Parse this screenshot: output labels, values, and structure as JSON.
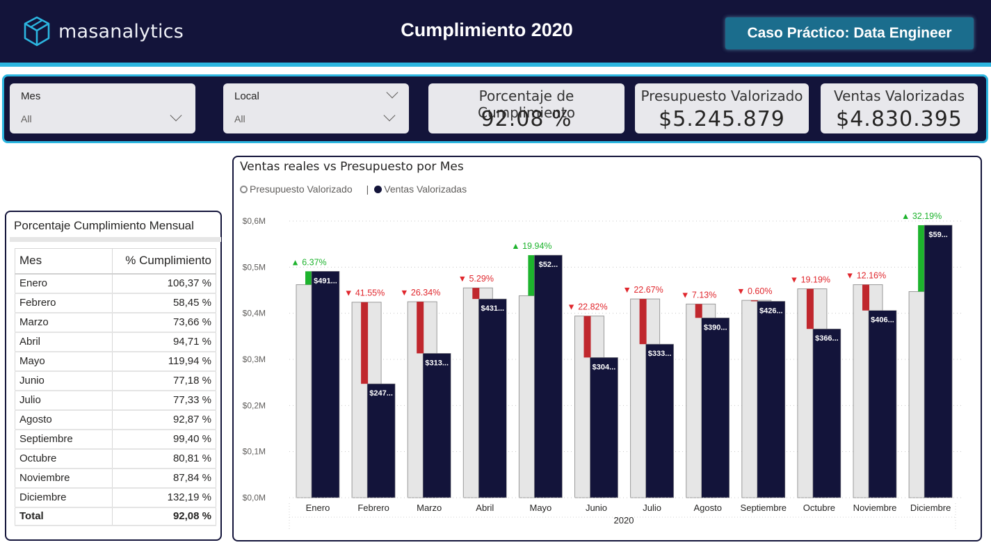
{
  "header": {
    "logo_text": "masanalytics",
    "title": "Cumplimiento 2020",
    "badge": "Caso Práctico: Data Engineer"
  },
  "filters": {
    "mes": {
      "title": "Mes",
      "value": "All",
      "icon": "chevron-down-icon"
    },
    "local": {
      "title": "Local",
      "value": "All",
      "icon": "chevron-down-icon"
    }
  },
  "kpis": {
    "cumplimiento": {
      "label": "Porcentaje de Cumplimiento",
      "value": "92.08 %"
    },
    "presupuesto": {
      "label": "Presupuesto Valorizado",
      "value": "$5.245.879"
    },
    "ventas": {
      "label": "Ventas Valorizadas",
      "value": "$4.830.395"
    }
  },
  "monthly_table": {
    "title": "Porcentaje Cumplimiento Mensual",
    "columns": [
      "Mes",
      "% Cumplimiento"
    ],
    "rows": [
      [
        "Enero",
        "106,37 %"
      ],
      [
        "Febrero",
        "58,45 %"
      ],
      [
        "Marzo",
        "73,66 %"
      ],
      [
        "Abril",
        "94,71 %"
      ],
      [
        "Mayo",
        "119,94 %"
      ],
      [
        "Junio",
        "77,18 %"
      ],
      [
        "Julio",
        "77,33 %"
      ],
      [
        "Agosto",
        "92,87 %"
      ],
      [
        "Septiembre",
        "99,40 %"
      ],
      [
        "Octubre",
        "80,81 %"
      ],
      [
        "Noviembre",
        "87,84 %"
      ],
      [
        "Diciembre",
        "132,19 %"
      ]
    ],
    "total": [
      "Total",
      "92,08 %"
    ]
  },
  "colors": {
    "navy": "#13143a",
    "accent": "#2cb6e0",
    "budget_bar": "#e6e6e6",
    "positive": "#1db32d",
    "negative": "#c0272d",
    "negative_text": "#e0262c"
  },
  "chart_data": {
    "type": "bar",
    "title": "Ventas reales vs Presupuesto por Mes",
    "xlabel": "2020",
    "ylabel": "",
    "ylim": [
      0,
      0.6
    ],
    "yticks": [
      "$0,0M",
      "$0,1M",
      "$0,2M",
      "$0,3M",
      "$0,4M",
      "$0,5M",
      "$0,6M"
    ],
    "grid": true,
    "legend_position": "top-left",
    "categories": [
      "Enero",
      "Febrero",
      "Marzo",
      "Abril",
      "Mayo",
      "Junio",
      "Julio",
      "Agosto",
      "Septiembre",
      "Octubre",
      "Noviembre",
      "Diciembre"
    ],
    "series": [
      {
        "name": "Presupuesto Valorizado",
        "values": [
          0.462,
          0.424,
          0.425,
          0.455,
          0.438,
          0.394,
          0.431,
          0.42,
          0.428,
          0.453,
          0.462,
          0.447
        ]
      },
      {
        "name": "Ventas Valorizadas",
        "values": [
          0.491,
          0.247,
          0.313,
          0.431,
          0.526,
          0.304,
          0.333,
          0.39,
          0.426,
          0.366,
          0.406,
          0.591
        ]
      }
    ],
    "bar_labels": [
      "$491...",
      "$247...",
      "$313...",
      "$431...",
      "$52...",
      "$304...",
      "$333...",
      "$390...",
      "$426...",
      "$366...",
      "$406...",
      "$59..."
    ],
    "variance_labels": [
      "▲ 6.37%",
      "▼ 41.55%",
      "▼ 26.34%",
      "▼ 5.29%",
      "▲ 19.94%",
      "▼ 22.82%",
      "▼ 22.67%",
      "▼ 7.13%",
      "▼ 0.60%",
      "▼ 19.19%",
      "▼ 12.16%",
      "▲ 32.19%"
    ]
  }
}
